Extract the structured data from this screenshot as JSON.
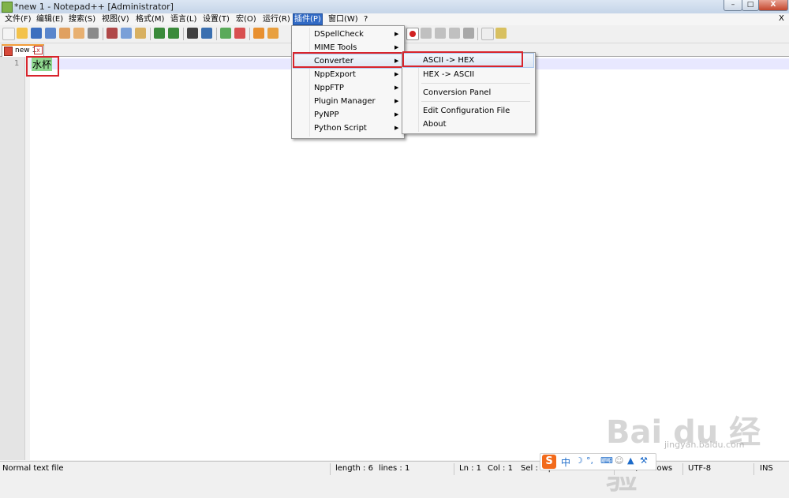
{
  "window": {
    "title": "*new 1 - Notepad++ [Administrator]",
    "min_glyph": "–",
    "max_glyph": "□",
    "close_glyph": "X"
  },
  "menubar": {
    "items": [
      "文件(F)",
      "编辑(E)",
      "搜索(S)",
      "视图(V)",
      "格式(M)",
      "语言(L)",
      "设置(T)",
      "宏(O)",
      "运行(R)",
      "插件(P)",
      "窗口(W)",
      "?"
    ],
    "close_glyph": "X"
  },
  "tab": {
    "label": "new 1",
    "close_glyph": "x"
  },
  "editor": {
    "line_number": "1",
    "line_text": "水杯"
  },
  "plugins_menu": {
    "items": [
      {
        "label": "DSpellCheck",
        "arrow": "▶"
      },
      {
        "label": "MIME Tools",
        "arrow": "▶"
      },
      {
        "label": "Converter",
        "arrow": "▶"
      },
      {
        "label": "NppExport",
        "arrow": "▶"
      },
      {
        "label": "NppFTP",
        "arrow": "▶"
      },
      {
        "label": "Plugin Manager",
        "arrow": "▶"
      },
      {
        "label": "PyNPP",
        "arrow": "▶"
      },
      {
        "label": "Python Script",
        "arrow": "▶"
      }
    ]
  },
  "converter_menu": {
    "items": [
      "ASCII -> HEX",
      "HEX -> ASCII",
      "Conversion Panel",
      "Edit Configuration File",
      "About"
    ]
  },
  "statusbar": {
    "file_type": "Normal text file",
    "length": "length : 6",
    "lines": "lines : 1",
    "ln": "Ln : 1",
    "col": "Col : 1",
    "sel": "Sel : 2 | 1",
    "eol": "Dos\\Windows",
    "encoding": "UTF-8",
    "mode": "INS"
  },
  "ime": {
    "logo": "S",
    "lang": "中",
    "moon": "☽",
    "punct": "°,",
    "keyboard": "⌨",
    "user": "☺",
    "shirt": "▲",
    "wrench": "⚒"
  },
  "watermark": {
    "text": "Bai du 经验",
    "url": "jingyan.baidu.com"
  },
  "colors": {
    "highlight_border": "#d8242c",
    "selection_green": "#8fd88f",
    "menu_active": "#316ac5"
  }
}
